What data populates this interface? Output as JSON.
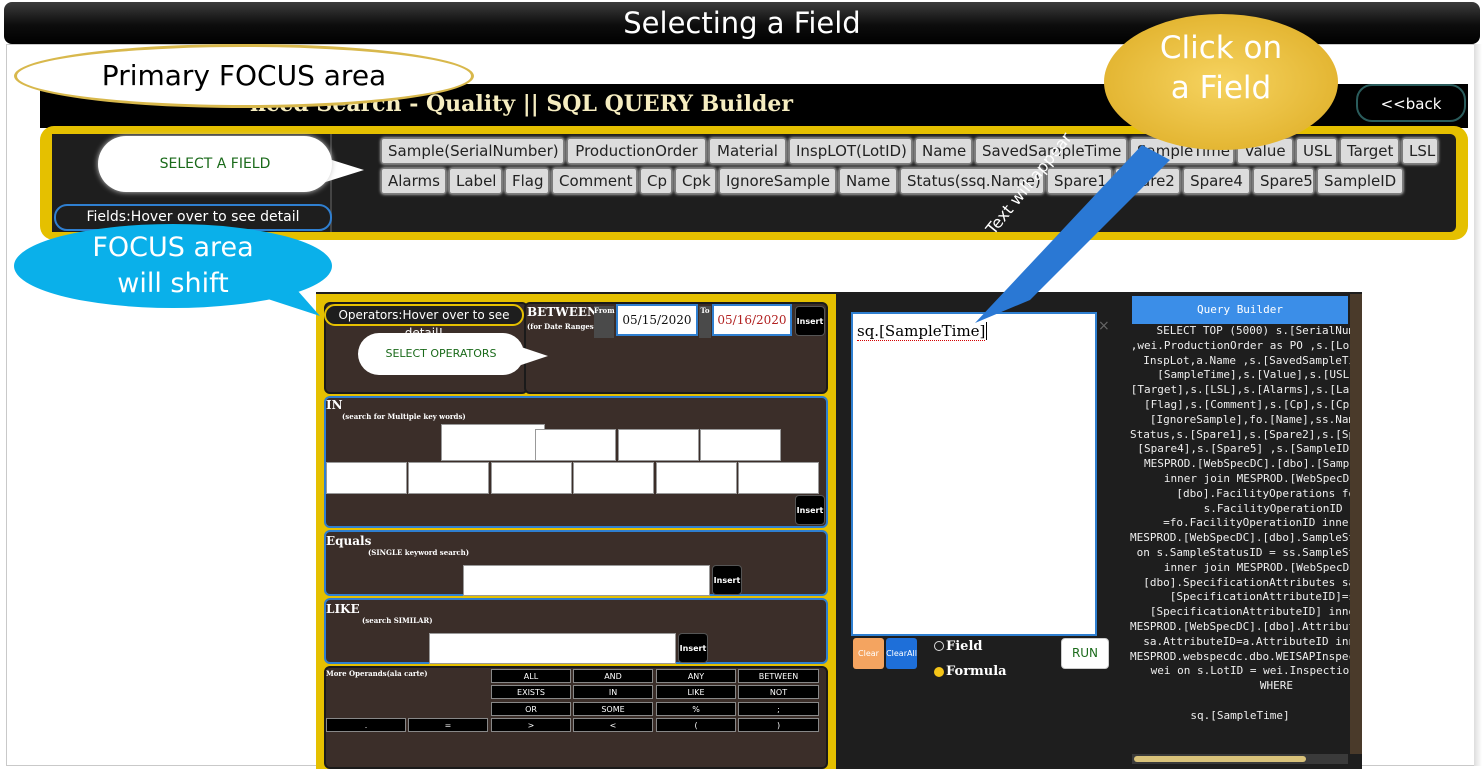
{
  "slide": {
    "title": "Selecting a Field"
  },
  "callouts": {
    "primary_focus": "Primary FOCUS area",
    "click_field_line1": "Click on",
    "click_field_line2": "a Field",
    "focus_shift_line1": "FOCUS area",
    "focus_shift_line2": "will shift",
    "select_field": "SELECT A FIELD",
    "select_operators": "SELECT OPERATORS",
    "text_will_appear": "Text will appear"
  },
  "header": {
    "title": "nced Search - Quality || SQL QUERY Builder",
    "back_label": "<<back"
  },
  "fields_panel": {
    "hover_label": "Fields:Hover over to see detail",
    "row1": [
      "Sample(SerialNumber)",
      "ProductionOrder",
      "Material",
      "InspLOT(LotID)",
      "Name",
      "SavedSampleTime",
      "SampleTime",
      "Value",
      "USL",
      "Target",
      "LSL"
    ],
    "row2": [
      "Alarms",
      "Label",
      "Flag",
      "Comment",
      "Cp",
      "Cpk",
      "IgnoreSample",
      "Name",
      "Status(ssq.Name)",
      "Spare1",
      "Spare2",
      "Spare4",
      "Spare5",
      "SampleID"
    ]
  },
  "operators": {
    "hover_label": "Operators:Hover over to see detail!",
    "between": {
      "title": "BETWEEN",
      "subtitle": "(for Date Ranges)",
      "from_label": "From",
      "from_value": "05/15/2020",
      "to_label": "To",
      "to_value": "05/16/2020"
    },
    "in": {
      "title": "IN",
      "subtitle": "(search for Multiple key words)"
    },
    "equals": {
      "title": "Equals",
      "subtitle": "(SINGLE keyword search)"
    },
    "like": {
      "title": "LIKE",
      "subtitle": "(search SIMILAR)"
    },
    "more": {
      "title": "More Operands(ala carte)",
      "buttons": [
        "ALL",
        "AND",
        "ANY",
        "BETWEEN",
        "EXISTS",
        "IN",
        "LIKE",
        "NOT",
        "OR",
        "SOME",
        "%",
        ";",
        ".",
        "=",
        ">",
        "<",
        "(",
        ")"
      ]
    },
    "insert_label": "Insert"
  },
  "editor": {
    "text": "sq.[SampleTime]",
    "close": "×",
    "clear": "Clear",
    "clear_all": "ClearAll",
    "radio_field": "Field",
    "radio_formula": "Formula",
    "run": "RUN"
  },
  "query_builder": {
    "title": "Query Builder",
    "sql": "    SELECT TOP (5000) s.[SerialNum\n,wei.ProductionOrder as PO ,s.[Lo\n  InspLot,a.Name ,s.[SavedSampleTi\n    [SampleTime],s.[Value],s.[USL\n[Target],s.[LSL],s.[Alarms],s.[La\n  [Flag],s.[Comment],s.[Cp],s.[Cp\n   [IgnoreSample],fo.[Name],ss.Nam\nStatus,s.[Spare1],s.[Spare2],s.[Sp\n [Spare4],s.[Spare5] ,s.[SampleID\n  MESPROD.[WebSpecDC].[dbo].[Samp\n     inner join MESPROD.[WebSpecD\n       [dbo].FacilityOperations fo\n          s.FacilityOperationID\n     =fo.FacilityOperationID inner\nMESPROD.[WebSpecDC].[dbo].SampleSt\n on s.SampleStatusID = ss.SampleSt\n     inner join MESPROD.[WebSpecD\n  [dbo].SpecificationAttributes sa\n      [SpecificationAttributeID]=s\n   [SpecificationAttributeID] inne\nMESPROD.[WebSpecDC].[dbo].Attribut\n  sa.AttributeID=a.AttributeID inne\nMESPROD.webspecdc.dbo.WEISAPInspec\n   wei on s.LotID = wei.Inspectio\n           WHERE\n\nsq.[SampleTime]"
  },
  "colors": {
    "focus_yellow": "#e5c000",
    "panel_dark": "#1e1e1e",
    "operator_brown": "#3b2e29",
    "accent_blue": "#2f7fd0",
    "callout_gold": "#dcaa20",
    "callout_cyan": "#0ab0ea"
  }
}
